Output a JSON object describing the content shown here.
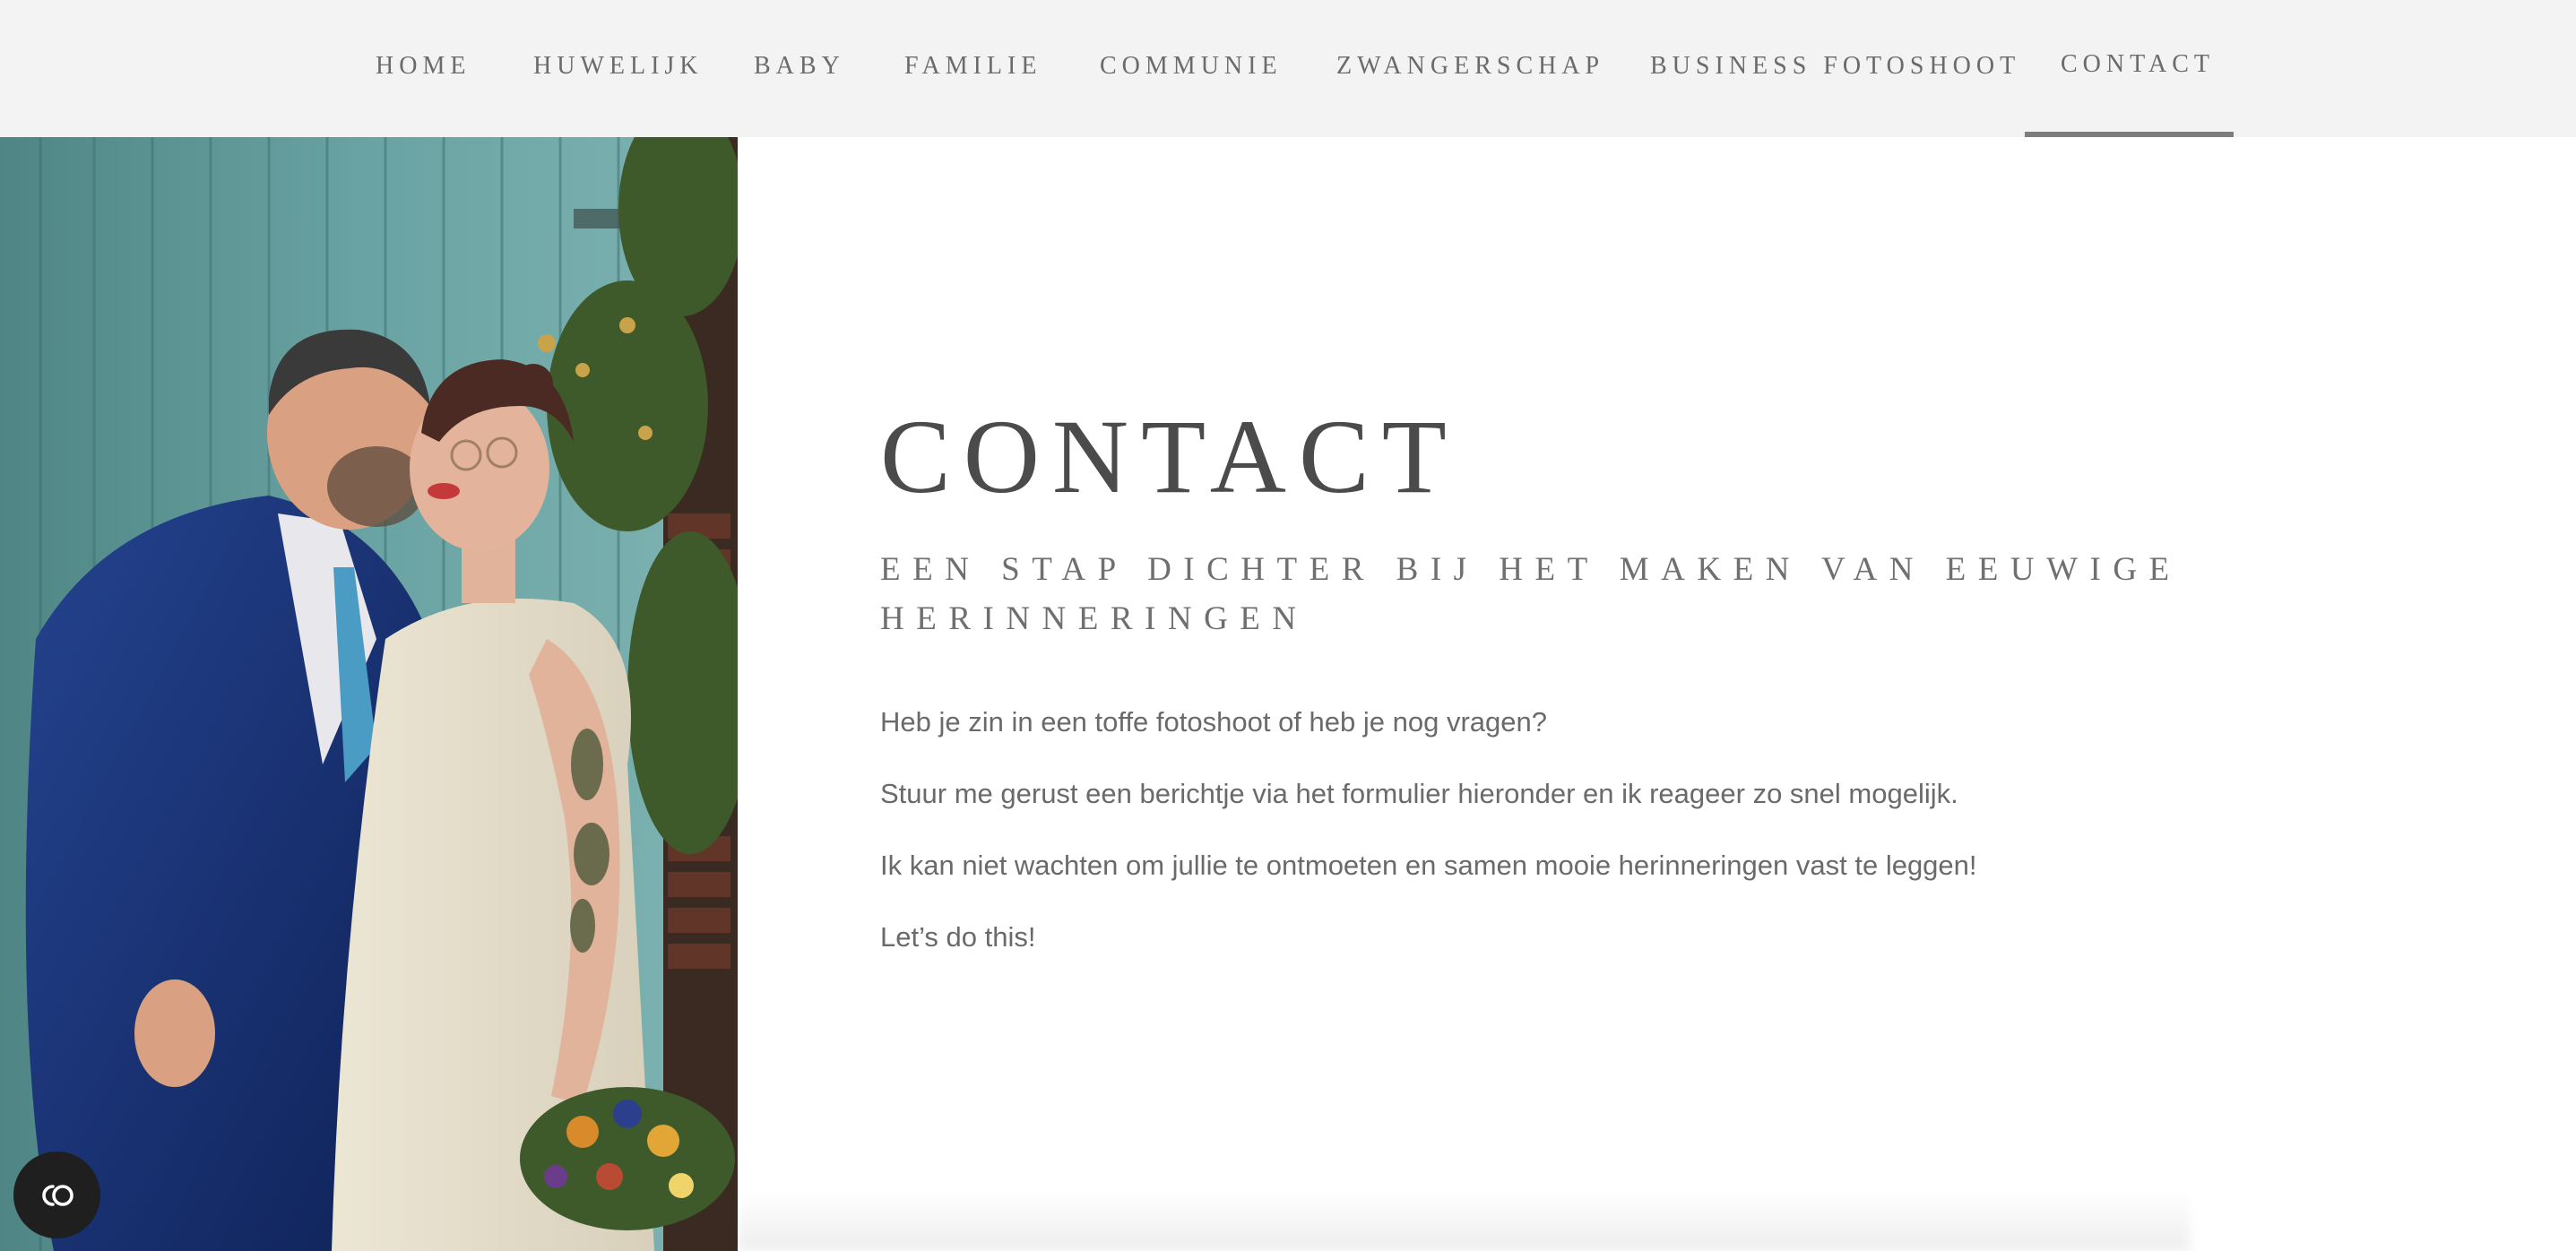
{
  "nav": {
    "items": [
      {
        "label": "HOME"
      },
      {
        "label": "HUWELIJK"
      },
      {
        "label": "BABY"
      },
      {
        "label": "FAMILIE"
      },
      {
        "label": "COMMUNIE"
      },
      {
        "label": "ZWANGERSCHAP"
      },
      {
        "label": "BUSINESS FOTOSHOOT"
      },
      {
        "label": "CONTACT",
        "active": true
      }
    ]
  },
  "hero": {
    "image_alt": "Wedding couple touching noses in front of a weathered teal wooden door"
  },
  "main": {
    "title": "CONTACT",
    "subtitle": "EEN STAP DICHTER BIJ HET MAKEN VAN EEUWIGE HERINNERINGEN",
    "paragraphs": [
      "Heb je zin in een toffe fotoshoot of heb je nog vragen?",
      "Stuur me gerust een berichtje via het formulier hieronder en ik reageer zo snel mogelijk.",
      "Ik kan niet wachten om jullie te ontmoeten en samen mooie herinneringen vast te leggen!",
      "Let’s do this!"
    ]
  },
  "cookie": {
    "icon": "cookie-consent-icon"
  },
  "colors": {
    "nav_bg": "#f3f3f3",
    "nav_text": "#6b6b6b",
    "active_underline": "#7d7d7d",
    "title": "#4b4b4b",
    "body_text": "#6a6a6a"
  }
}
